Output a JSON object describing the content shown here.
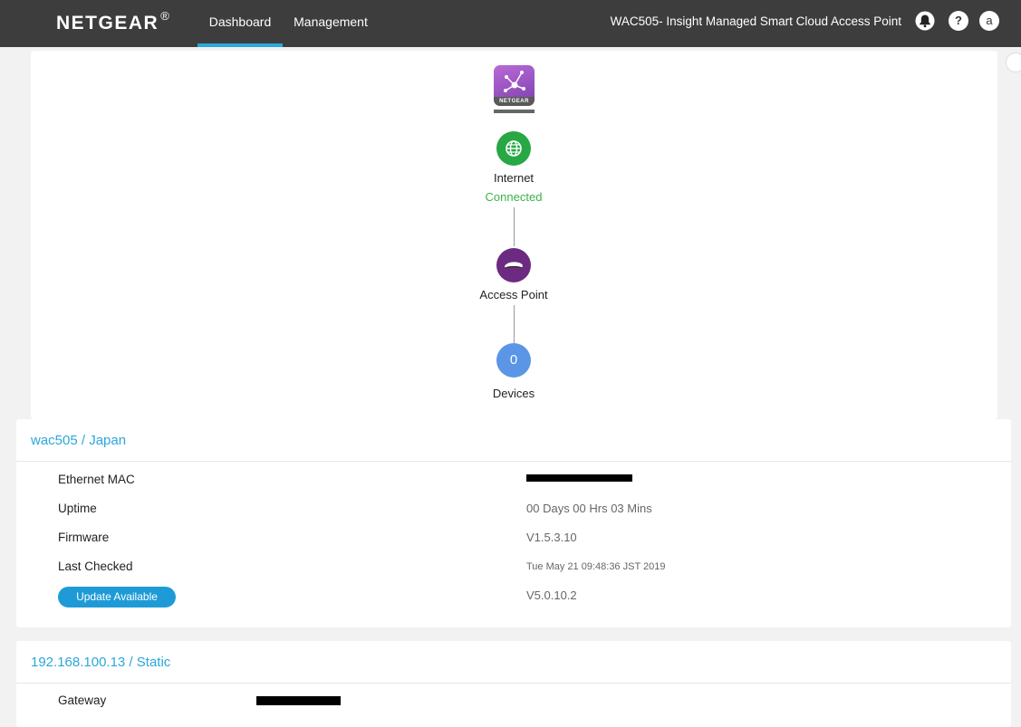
{
  "header": {
    "logo": "NETGEAR",
    "logo_mark": "®",
    "tabs": [
      {
        "label": "Dashboard",
        "active": true
      },
      {
        "label": "Management",
        "active": false
      }
    ],
    "device_title": "WAC505- Insight Managed Smart Cloud Access Point",
    "icons": [
      "bell-icon",
      "help-icon",
      "user-avatar-icon"
    ],
    "help_glyph": "?",
    "avatar_letter": "a",
    "accent_color": "#2aa7dc"
  },
  "topology": {
    "cloud_brand": "NETGEAR",
    "internet": {
      "label": "Internet",
      "status": "Connected",
      "status_color": "#39b34a"
    },
    "access_point": {
      "label": "Access Point"
    },
    "devices": {
      "count": "0",
      "label": "Devices"
    }
  },
  "device_card": {
    "title": "wac505 / Japan",
    "rows": [
      {
        "label": "Ethernet MAC",
        "value": ""
      },
      {
        "label": "Uptime",
        "value": "00 Days 00 Hrs 03 Mins"
      },
      {
        "label": "Firmware",
        "value": "V1.5.3.10"
      },
      {
        "label": "Last Checked",
        "value": "Tue May 21 09:48:36 JST 2019"
      }
    ],
    "update_button": "Update Available",
    "update_version": "V5.0.10.2"
  },
  "network_card": {
    "title": "192.168.100.13 / Static",
    "rows": [
      {
        "label": "Gateway",
        "value": ""
      }
    ]
  }
}
